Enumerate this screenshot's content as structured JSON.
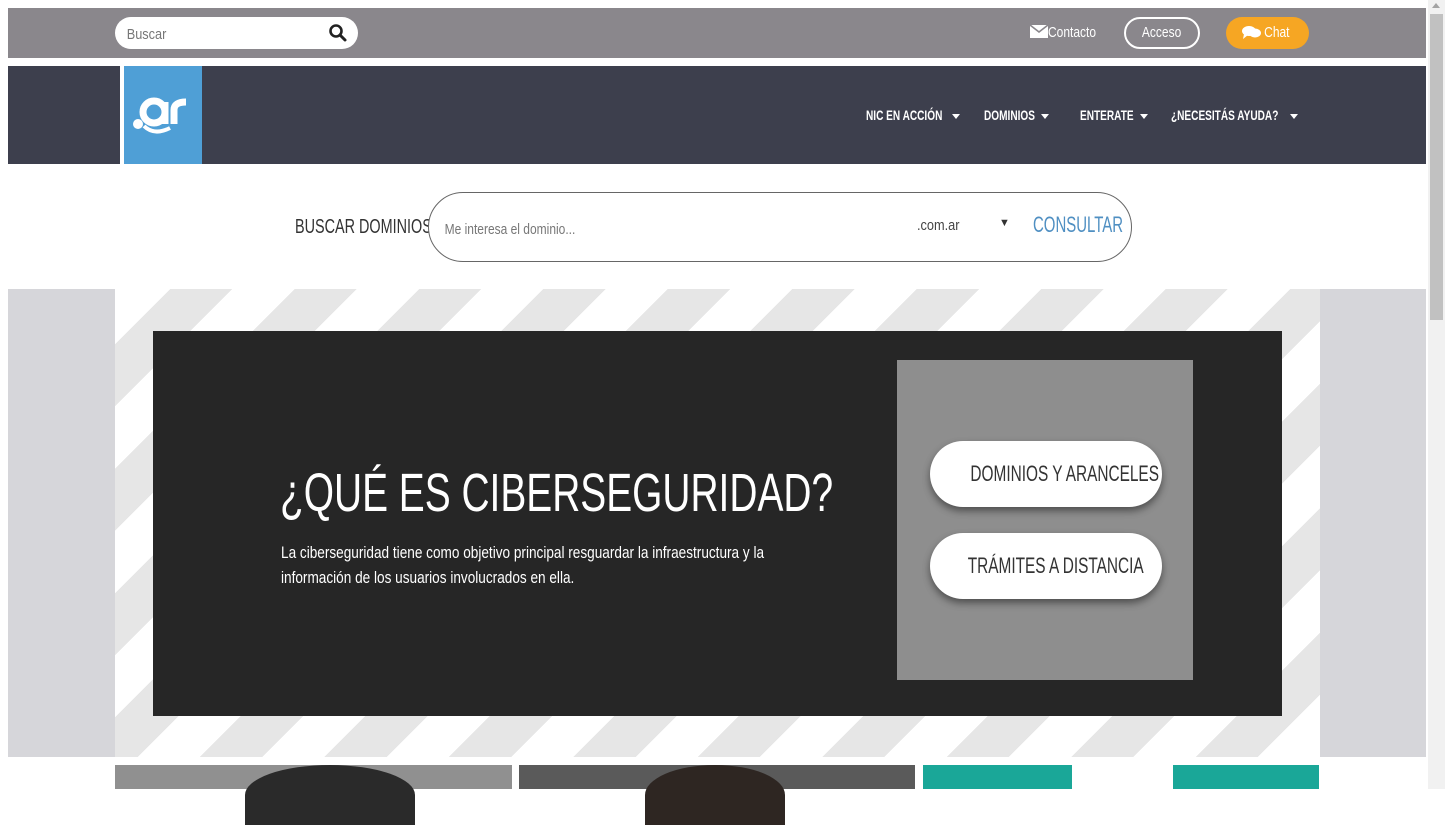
{
  "topbar": {
    "search_placeholder": "Buscar",
    "contact_label": "Contacto",
    "login_label": "Acceso",
    "chat_label": "Chat",
    "chat_color": "#f6a623"
  },
  "nav": {
    "logo_text": ".ar",
    "items": [
      {
        "label": "NIC EN ACCIÓN"
      },
      {
        "label": "DOMINIOS"
      },
      {
        "label": "ENTERATE"
      },
      {
        "label": "¿NECESITÁS AYUDA?"
      }
    ]
  },
  "domain_search": {
    "label": "BUSCAR DOMINIOS",
    "placeholder": "Me interesa el dominio...",
    "tld": ".com.ar",
    "submit_label": "CONSULTAR"
  },
  "hero": {
    "title": "¿QUÉ ES CIBERSEGURIDAD?",
    "text": "La ciberseguridad tiene como objetivo principal resguardar la infraestructura y la información de los usuarios involucrados en ella.",
    "buttons": [
      {
        "label": "DOMINIOS Y ARANCELES"
      },
      {
        "label": "TRÁMITES A DISTANCIA"
      }
    ]
  }
}
